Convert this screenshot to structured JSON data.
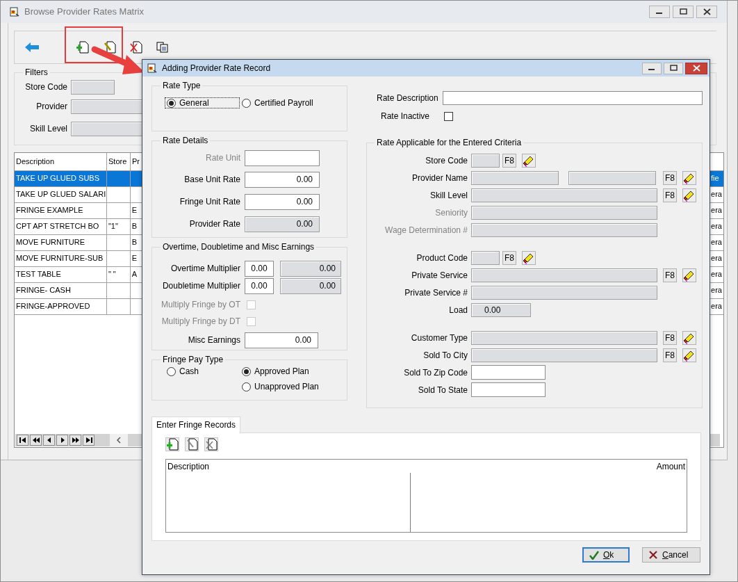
{
  "window": {
    "title": "Browse Provider Rates Matrix"
  },
  "filters": {
    "title": "Filters",
    "fields": [
      {
        "label": "Store Code",
        "kind": "short"
      },
      {
        "label": "Provider",
        "kind": "long"
      },
      {
        "label": "Skill Level",
        "kind": "long"
      }
    ]
  },
  "table": {
    "columns": [
      "Description",
      "Store",
      "Pr"
    ],
    "rows": [
      {
        "cells": [
          "TAKE UP GLUED SUBS",
          "",
          ""
        ],
        "column_4": "fie",
        "selected": true
      },
      {
        "cells": [
          "TAKE UP GLUED SALARI",
          "",
          ""
        ],
        "column_4": "era",
        "selected": false
      },
      {
        "cells": [
          "FRINGE EXAMPLE",
          "",
          "E"
        ],
        "column_4": "era",
        "selected": false
      },
      {
        "cells": [
          "CPT APT STRETCH BO",
          "\"1\"",
          "B"
        ],
        "column_4": "era",
        "selected": false
      },
      {
        "cells": [
          "MOVE FURNITURE",
          "",
          "B"
        ],
        "column_4": "era",
        "selected": false
      },
      {
        "cells": [
          "MOVE FURNITURE-SUB",
          "",
          "E"
        ],
        "column_4": "era",
        "selected": false
      },
      {
        "cells": [
          "TEST TABLE",
          "\" \"",
          "A"
        ],
        "column_4": "era",
        "selected": false
      },
      {
        "cells": [
          "FRINGE- CASH",
          "",
          ""
        ],
        "column_4": "era",
        "selected": false
      },
      {
        "cells": [
          "FRINGE-APPROVED",
          "",
          ""
        ],
        "column_4": "era",
        "selected": false
      }
    ]
  },
  "dialog": {
    "title": "Adding Provider Rate Record",
    "rate_type": {
      "title": "Rate Type",
      "options": [
        {
          "label": "General",
          "selected": true,
          "focused": true
        },
        {
          "label": "Certified Payroll",
          "selected": false,
          "focused": false
        }
      ]
    },
    "rate_description": {
      "label": "Rate Description"
    },
    "rate_inactive": {
      "label": "Rate Inactive",
      "checked": false
    },
    "rate_details": {
      "title": "Rate Details",
      "fields": [
        {
          "label": "Rate Unit",
          "disabled": true,
          "readonly": false
        },
        {
          "label": "Base Unit Rate",
          "disabled": false,
          "readonly": false,
          "value": "0.00"
        },
        {
          "label": "Fringe Unit Rate",
          "disabled": false,
          "readonly": false,
          "value": "0.00"
        },
        {
          "label": "Provider Rate",
          "disabled": false,
          "readonly": true,
          "value": "0.00"
        }
      ]
    },
    "earnings": {
      "title": "Overtime, Doubletime and Misc Earnings",
      "multipliers": [
        {
          "label": "Overtime Multiplier",
          "value": "0.00",
          "result": "0.00"
        },
        {
          "label": "Doubletime Multiplier",
          "value": "0.00",
          "result": "0.00"
        }
      ],
      "checks": [
        {
          "label": "Multiply Fringe by OT",
          "checked": false,
          "disabled": true
        },
        {
          "label": "Multiply Fringe by DT",
          "checked": false,
          "disabled": true
        }
      ],
      "misc": {
        "label": "Misc Earnings",
        "value": "0.00"
      }
    },
    "fringe_pay_type": {
      "title": "Fringe Pay Type",
      "options": [
        {
          "label": "Cash",
          "selected": false
        },
        {
          "label": "Approved Plan",
          "selected": true
        },
        {
          "label": "Unapproved Plan",
          "selected": false
        }
      ]
    },
    "criteria": {
      "title": "Rate Applicable for the Entered Criteria",
      "groups": [
        [
          {
            "label": "Store Code",
            "kind": "short",
            "lookup": "F8",
            "disabled": false
          },
          {
            "label": "Provider Name",
            "kind": "pair",
            "lookup": "F8",
            "disabled": false
          },
          {
            "label": "Skill Level",
            "kind": "long",
            "lookup": "F8",
            "disabled": false
          },
          {
            "label": "Seniority",
            "kind": "long",
            "disabled": true
          },
          {
            "label": "Wage Determination #",
            "kind": "long",
            "disabled": true
          }
        ],
        [
          {
            "label": "Product Code",
            "kind": "short",
            "lookup": "F8",
            "disabled": false
          },
          {
            "label": "Private Service",
            "kind": "long",
            "lookup": "F8",
            "disabled": false
          },
          {
            "label": "Private Service #",
            "kind": "long",
            "disabled": false
          },
          {
            "label": "Load",
            "kind": "medium",
            "value": "0.00",
            "disabled": false
          }
        ],
        [
          {
            "label": "Customer Type",
            "kind": "long",
            "lookup": "F8",
            "disabled": false
          },
          {
            "label": "Sold To City",
            "kind": "long",
            "lookup": "F8",
            "disabled": false
          },
          {
            "label": "Sold To Zip Code",
            "kind": "entry",
            "disabled": false
          },
          {
            "label": "Sold To State",
            "kind": "entry",
            "disabled": false
          }
        ]
      ]
    },
    "tab": {
      "label": "Enter Fringe Records",
      "selected": true
    },
    "fringe_table": {
      "columns": [
        "Description",
        "Amount"
      ]
    },
    "buttons": [
      {
        "label": "Ok",
        "kind": "ok",
        "default": true
      },
      {
        "label": "Cancel",
        "kind": "cancel",
        "default": false
      }
    ]
  }
}
